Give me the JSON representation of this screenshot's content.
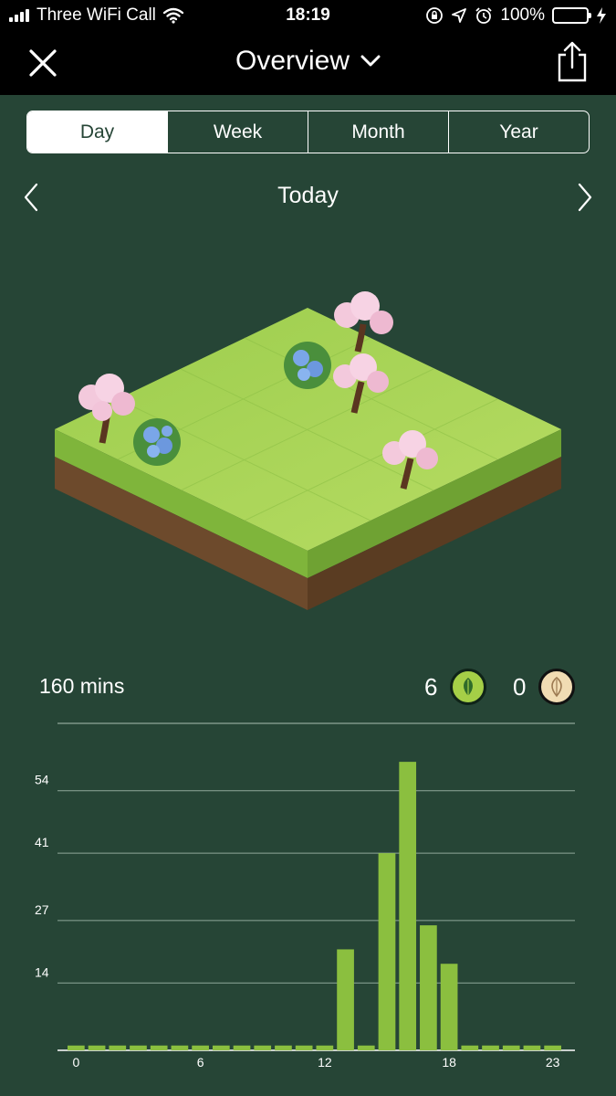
{
  "status_bar": {
    "carrier": "Three WiFi Call",
    "time": "18:19",
    "battery_percent": "100%",
    "icons": [
      "signal-icon",
      "wifi-icon",
      "orientation-lock-icon",
      "location-icon",
      "alarm-icon",
      "battery-icon",
      "charging-icon"
    ]
  },
  "nav": {
    "title": "Overview",
    "close_icon": "close-icon",
    "dropdown_icon": "chevron-down-icon",
    "share_icon": "share-icon"
  },
  "segments": {
    "items": [
      {
        "label": "Day",
        "active": true
      },
      {
        "label": "Week",
        "active": false
      },
      {
        "label": "Month",
        "active": false
      },
      {
        "label": "Year",
        "active": false
      }
    ]
  },
  "period": {
    "label": "Today",
    "prev_icon": "chevron-left-icon",
    "next_icon": "chevron-right-icon"
  },
  "stats": {
    "total": "160 mins",
    "healthy_count": "6",
    "dead_count": "0"
  },
  "colors": {
    "background": "#264536",
    "header": "#000000",
    "bar": "#8bbf3f",
    "healthy_badge": "#a5cf47",
    "dead_badge": "#f1dcb3"
  },
  "chart_data": {
    "type": "bar",
    "x": [
      0,
      1,
      2,
      3,
      4,
      5,
      6,
      7,
      8,
      9,
      10,
      11,
      12,
      13,
      14,
      15,
      16,
      17,
      18,
      19,
      20,
      21,
      22,
      23
    ],
    "values": [
      1,
      1,
      1,
      1,
      1,
      1,
      1,
      1,
      1,
      1,
      1,
      1,
      1,
      21,
      1,
      41,
      60,
      26,
      18,
      1,
      1,
      1,
      1,
      1
    ],
    "y_ticks": [
      "14",
      "27",
      "41",
      "54"
    ],
    "x_ticks": [
      "0",
      "6",
      "12",
      "18",
      "23"
    ],
    "ylim": [
      0,
      68
    ],
    "grid": true
  }
}
